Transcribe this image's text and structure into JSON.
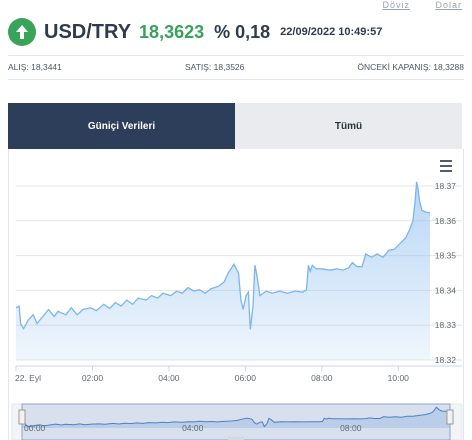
{
  "top_links": [
    "Döviz",
    "Dolar"
  ],
  "header": {
    "pair": "USD/TRY",
    "price": "18,3623",
    "change": "% 0,18",
    "timestamp": "22/09/2022 10:49:57",
    "direction_icon": "up-arrow-icon",
    "up_color": "#37a35a"
  },
  "info": {
    "bid": "ALIŞ: 18,3441",
    "ask": "SATIŞ: 18,3526",
    "prev_close": "ÖNCEKİ KAPANIŞ: 18,3288"
  },
  "tabs": [
    {
      "label": "Güniçi Verileri",
      "active": true
    },
    {
      "label": "Tümü",
      "active": false
    }
  ],
  "menu_icon": "hamburger-icon",
  "chart_data": {
    "type": "area",
    "title": "",
    "xlabel": "",
    "ylabel": "",
    "x_ticks": [
      "22. Eyl",
      "02:00",
      "04:00",
      "06:00",
      "08:00",
      "10:00"
    ],
    "y_ticks": [
      "18.32",
      "18.33",
      "18.34",
      "18.35",
      "18.36",
      "18.37"
    ],
    "ylim": [
      18.32,
      18.37
    ],
    "xlim_hours": [
      0,
      10.83
    ],
    "series": [
      {
        "color": "#7cb5ec",
        "points": [
          [
            0.0,
            18.335
          ],
          [
            0.08,
            18.3355
          ],
          [
            0.12,
            18.3305
          ],
          [
            0.2,
            18.329
          ],
          [
            0.32,
            18.3315
          ],
          [
            0.45,
            18.333
          ],
          [
            0.55,
            18.3305
          ],
          [
            0.7,
            18.3325
          ],
          [
            0.85,
            18.3345
          ],
          [
            1.0,
            18.3325
          ],
          [
            1.1,
            18.334
          ],
          [
            1.3,
            18.333
          ],
          [
            1.45,
            18.335
          ],
          [
            1.6,
            18.333
          ],
          [
            1.75,
            18.3345
          ],
          [
            1.95,
            18.335
          ],
          [
            2.1,
            18.3342
          ],
          [
            2.3,
            18.336
          ],
          [
            2.45,
            18.3348
          ],
          [
            2.6,
            18.3365
          ],
          [
            2.75,
            18.3355
          ],
          [
            2.9,
            18.3372
          ],
          [
            3.05,
            18.336
          ],
          [
            3.2,
            18.3378
          ],
          [
            3.4,
            18.3372
          ],
          [
            3.55,
            18.3385
          ],
          [
            3.7,
            18.3378
          ],
          [
            3.85,
            18.3392
          ],
          [
            4.05,
            18.3385
          ],
          [
            4.2,
            18.3398
          ],
          [
            4.35,
            18.3392
          ],
          [
            4.5,
            18.3408
          ],
          [
            4.65,
            18.3398
          ],
          [
            4.8,
            18.3402
          ],
          [
            4.95,
            18.3392
          ],
          [
            5.1,
            18.3405
          ],
          [
            5.3,
            18.3412
          ],
          [
            5.45,
            18.3425
          ],
          [
            5.55,
            18.345
          ],
          [
            5.7,
            18.3475
          ],
          [
            5.82,
            18.345
          ],
          [
            5.88,
            18.3375
          ],
          [
            5.94,
            18.3345
          ],
          [
            6.02,
            18.3385
          ],
          [
            6.08,
            18.3395
          ],
          [
            6.13,
            18.3288
          ],
          [
            6.2,
            18.3355
          ],
          [
            6.25,
            18.3472
          ],
          [
            6.3,
            18.3445
          ],
          [
            6.38,
            18.3385
          ],
          [
            6.55,
            18.3398
          ],
          [
            6.7,
            18.3392
          ],
          [
            6.9,
            18.3398
          ],
          [
            7.1,
            18.3392
          ],
          [
            7.3,
            18.3398
          ],
          [
            7.5,
            18.3395
          ],
          [
            7.6,
            18.3402
          ],
          [
            7.65,
            18.3472
          ],
          [
            7.7,
            18.3455
          ],
          [
            7.75,
            18.3472
          ],
          [
            7.85,
            18.3462
          ],
          [
            8.0,
            18.3462
          ],
          [
            8.2,
            18.3458
          ],
          [
            8.4,
            18.3462
          ],
          [
            8.55,
            18.3458
          ],
          [
            8.7,
            18.3465
          ],
          [
            8.8,
            18.348
          ],
          [
            8.92,
            18.3468
          ],
          [
            9.05,
            18.3468
          ],
          [
            9.15,
            18.3505
          ],
          [
            9.3,
            18.3495
          ],
          [
            9.45,
            18.3505
          ],
          [
            9.6,
            18.3495
          ],
          [
            9.75,
            18.3515
          ],
          [
            9.9,
            18.3518
          ],
          [
            10.05,
            18.3535
          ],
          [
            10.2,
            18.3552
          ],
          [
            10.3,
            18.3575
          ],
          [
            10.38,
            18.3598
          ],
          [
            10.44,
            18.3655
          ],
          [
            10.48,
            18.3712
          ],
          [
            10.52,
            18.369
          ],
          [
            10.56,
            18.3655
          ],
          [
            10.62,
            18.363
          ],
          [
            10.72,
            18.3625
          ],
          [
            10.83,
            18.3623
          ]
        ]
      }
    ],
    "navigator_ticks": [
      "00:00",
      "04:00",
      "08:00"
    ],
    "grid": true,
    "legend": "none"
  }
}
